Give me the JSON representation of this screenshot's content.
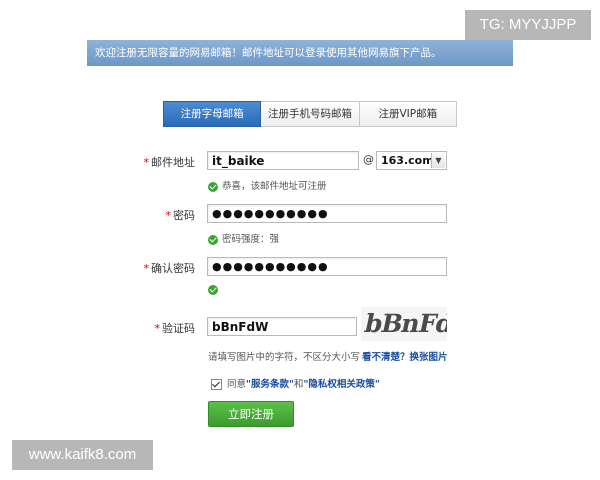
{
  "watermarks": {
    "tg": "TG: MYYJJPP",
    "site": "www.kaifk8.com"
  },
  "banner": {
    "text": "欢迎注册无限容量的网易邮箱！邮件地址可以登录使用其他网易旗下产品。"
  },
  "tabs": [
    {
      "label": "注册字母邮箱",
      "active": true
    },
    {
      "label": "注册手机号码邮箱",
      "active": false
    },
    {
      "label": "注册VIP邮箱",
      "active": false
    }
  ],
  "form": {
    "required_mark": "*",
    "email": {
      "label": "邮件地址",
      "value": "it_baike",
      "at": "@",
      "domain": "163.com",
      "hint": "恭喜，该邮件地址可注册"
    },
    "password": {
      "label": "密码",
      "value": "●●●●●●●●●●●",
      "hint": "密码强度：强"
    },
    "confirm": {
      "label": "确认密码",
      "value": "●●●●●●●●●●●"
    },
    "captcha": {
      "label": "验证码",
      "value": "bBnFdW",
      "image_text": "bBnFdW",
      "hint": "请填写图片中的字符，不区分大小写",
      "refresh": "看不清楚？换张图片"
    },
    "agree": {
      "prefix": "同意",
      "terms": "\"服务条款\"",
      "and": "和",
      "privacy": "\"隐私权相关政策\""
    },
    "submit": "立即注册"
  },
  "colors": {
    "banner": "#7aa3cf",
    "tab_active": "#2f74c2",
    "submit": "#4aac3a",
    "ok": "#3aa435",
    "required": "#d40000"
  }
}
